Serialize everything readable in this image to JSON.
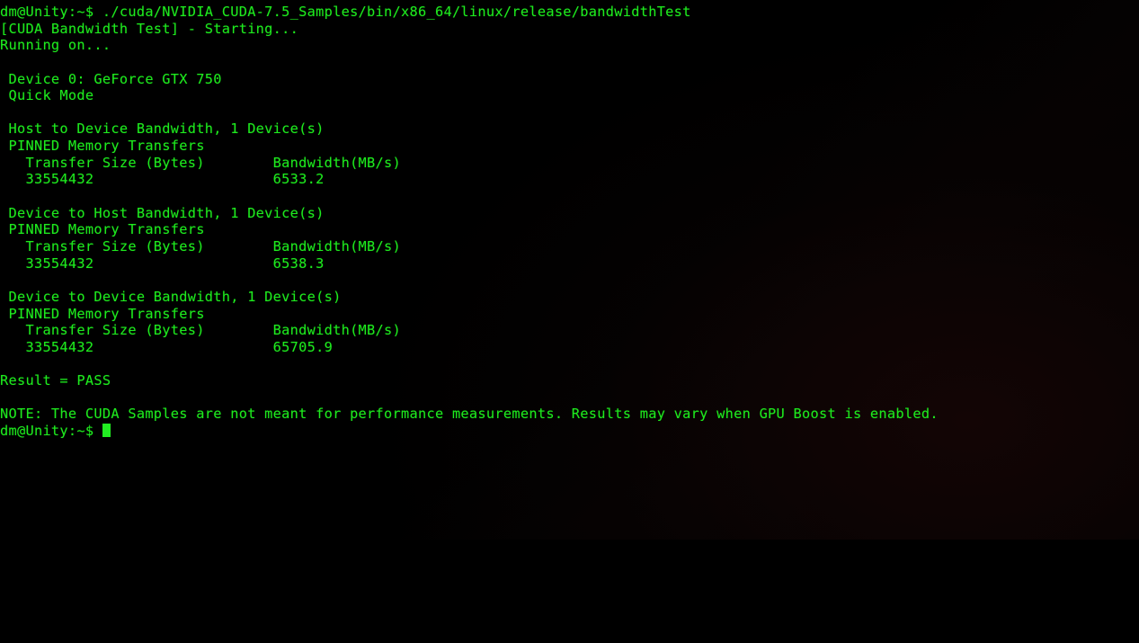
{
  "terminal": {
    "foreground_color": "#1eea1e",
    "background_color": "#000000",
    "cursor_color": "#22ee22",
    "prompt": "dm@Unity:~$",
    "command": "./cuda/NVIDIA_CUDA-7.5_Samples/bin/x86_64/linux/release/bandwidthTest",
    "lines": [
      "dm@Unity:~$ ./cuda/NVIDIA_CUDA-7.5_Samples/bin/x86_64/linux/release/bandwidthTest",
      "[CUDA Bandwidth Test] - Starting...",
      "Running on...",
      "",
      " Device 0: GeForce GTX 750",
      " Quick Mode",
      "",
      " Host to Device Bandwidth, 1 Device(s)",
      " PINNED Memory Transfers",
      "   Transfer Size (Bytes)        Bandwidth(MB/s)",
      "   33554432                     6533.2",
      "",
      " Device to Host Bandwidth, 1 Device(s)",
      " PINNED Memory Transfers",
      "   Transfer Size (Bytes)        Bandwidth(MB/s)",
      "   33554432                     6538.3",
      "",
      " Device to Device Bandwidth, 1 Device(s)",
      " PINNED Memory Transfers",
      "   Transfer Size (Bytes)        Bandwidth(MB/s)",
      "   33554432                     65705.9",
      "",
      "Result = PASS",
      "",
      "NOTE: The CUDA Samples are not meant for performance measurements. Results may vary when GPU Boost is enabled."
    ],
    "final_prompt": "dm@Unity:~$ ",
    "benchmark": {
      "title": "[CUDA Bandwidth Test] - Starting...",
      "status_line": "Running on...",
      "device_index": "Device 0",
      "device_name": "GeForce GTX 750",
      "mode": "Quick Mode",
      "result_label": "Result = PASS",
      "result_value": "PASS",
      "note": "NOTE: The CUDA Samples are not meant for performance measurements. Results may vary when GPU Boost is enabled.",
      "column_headers": [
        "Transfer Size (Bytes)",
        "Bandwidth(MB/s)"
      ],
      "memory_mode": "PINNED Memory Transfers",
      "sections": [
        {
          "heading": "Host to Device Bandwidth, 1 Device(s)",
          "transfer_size": "33554432",
          "bandwidth": "6533.2"
        },
        {
          "heading": "Device to Host Bandwidth, 1 Device(s)",
          "transfer_size": "33554432",
          "bandwidth": "6538.3"
        },
        {
          "heading": "Device to Device Bandwidth, 1 Device(s)",
          "transfer_size": "33554432",
          "bandwidth": "65705.9"
        }
      ]
    }
  }
}
